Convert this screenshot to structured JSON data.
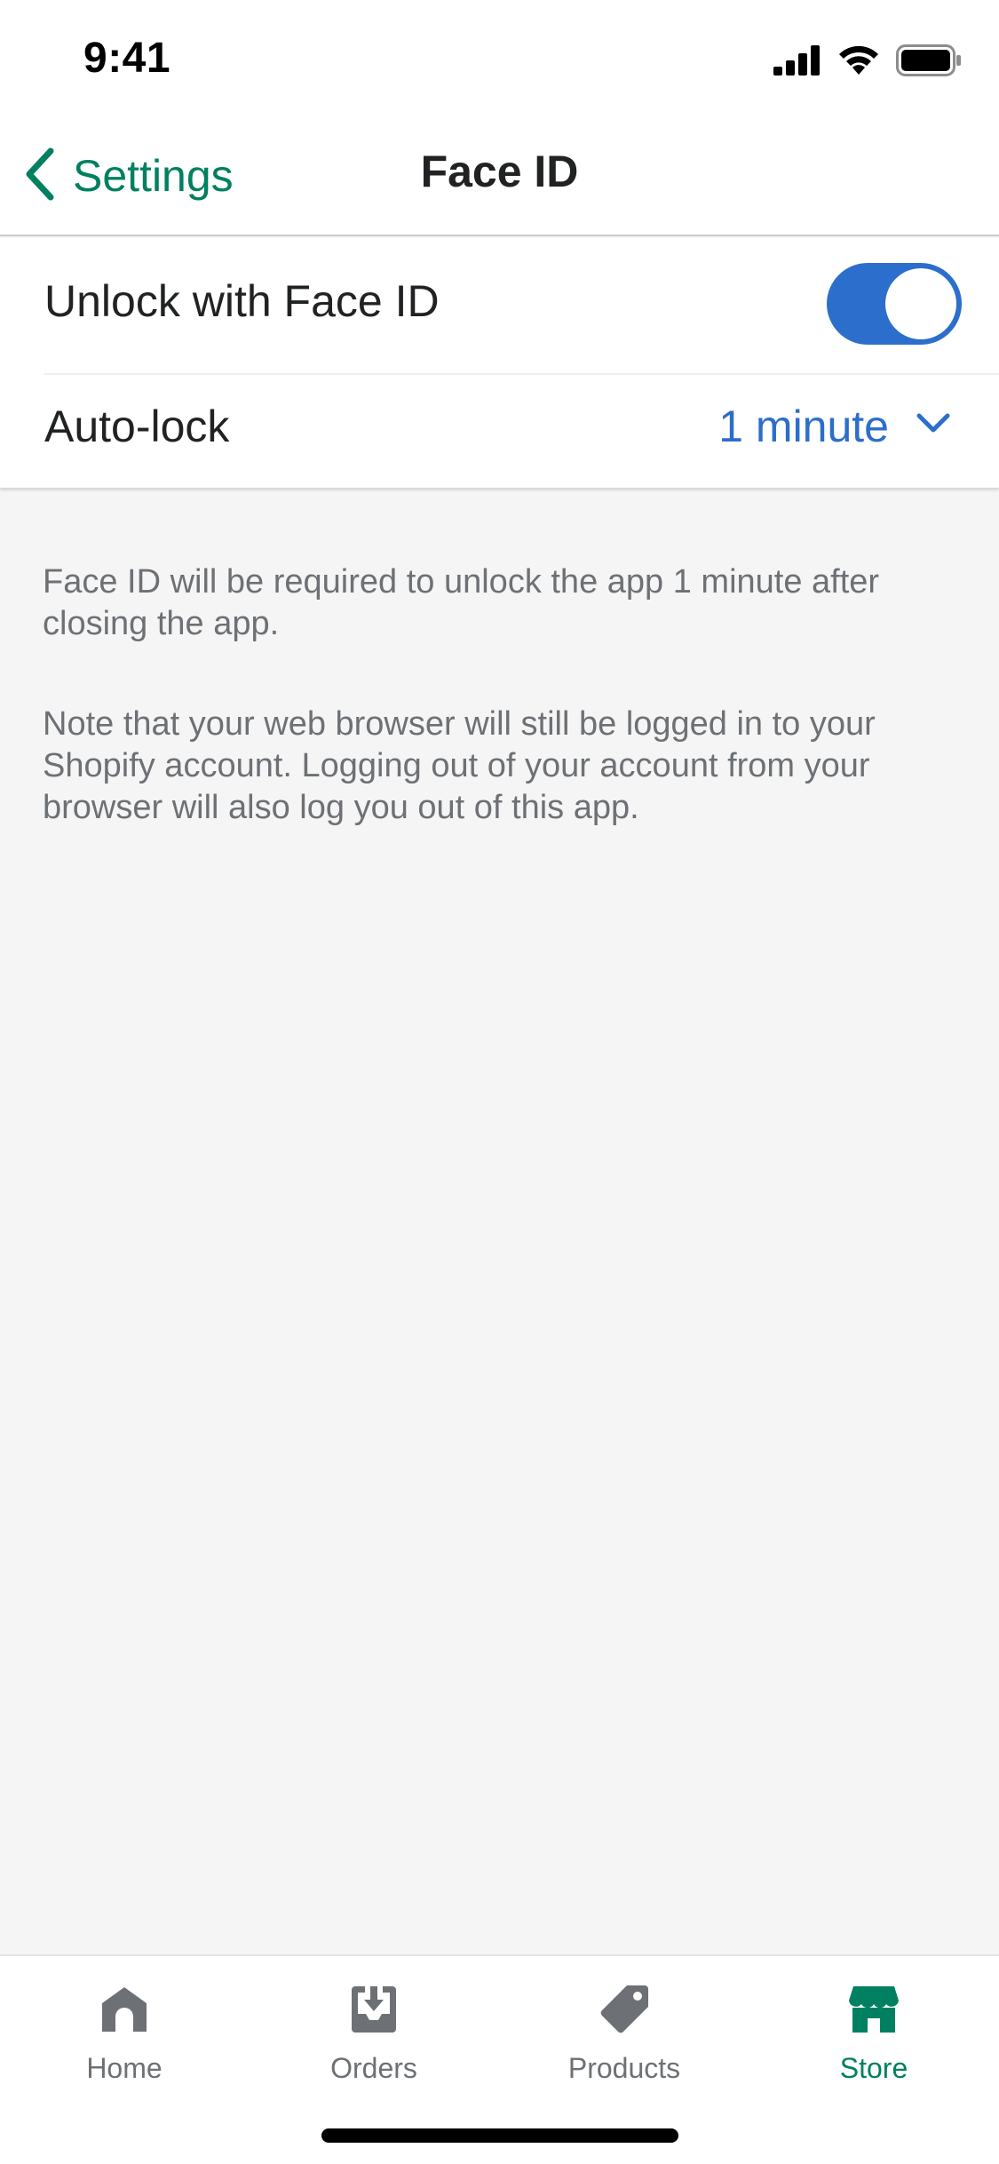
{
  "status_bar": {
    "time": "9:41",
    "icons": [
      "cellular-signal-icon",
      "wifi-icon",
      "battery-icon"
    ]
  },
  "nav": {
    "back_label": "Settings",
    "title": "Face ID"
  },
  "settings": {
    "unlock_label": "Unlock with Face ID",
    "unlock_enabled": true,
    "autolock_label": "Auto-lock",
    "autolock_value": "1 minute"
  },
  "help": {
    "text_1": "Face ID will be required to unlock the app 1 minute after closing the app.",
    "text_2": "Note that your web browser will still be logged in to your Shopify account. Logging out of your account from your browser will also log you out of this app."
  },
  "tabs": [
    {
      "label": "Home",
      "icon": "home-icon",
      "active": false
    },
    {
      "label": "Orders",
      "icon": "orders-inbox-icon",
      "active": false
    },
    {
      "label": "Products",
      "icon": "tag-icon",
      "active": false
    },
    {
      "label": "Store",
      "icon": "store-icon",
      "active": true
    }
  ],
  "colors": {
    "accent_green": "#008060",
    "toggle_blue": "#2c6ecb",
    "text_primary": "#202223",
    "text_secondary": "#6d7175",
    "background": "#f5f5f5"
  }
}
